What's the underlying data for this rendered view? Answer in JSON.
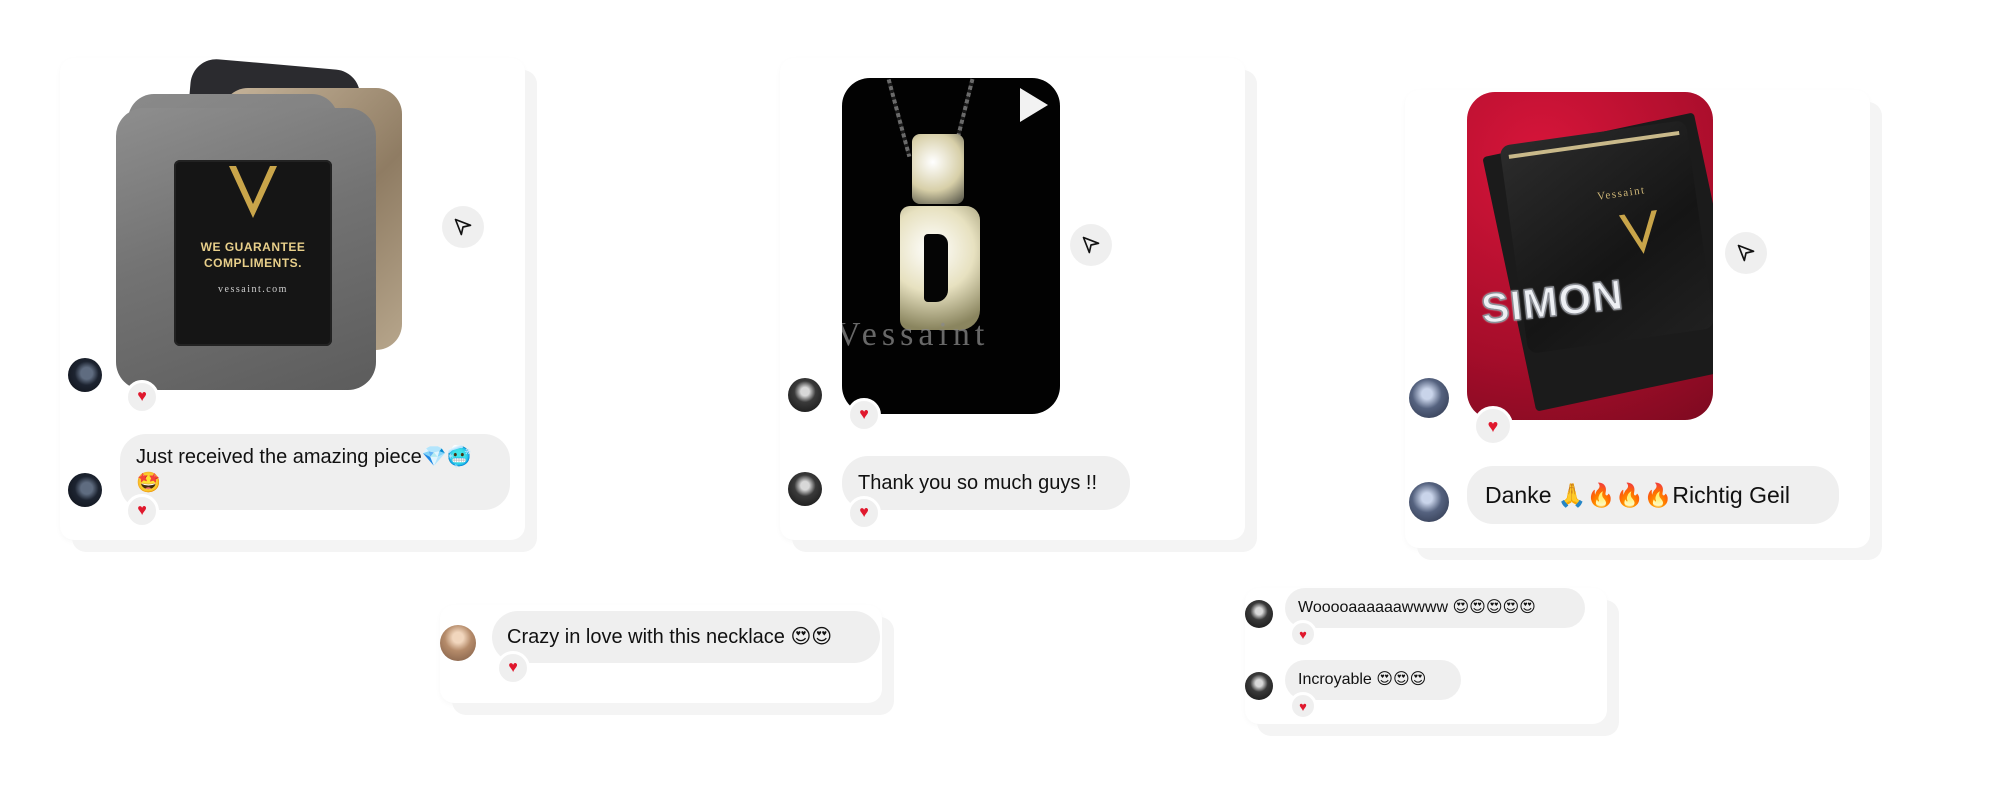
{
  "cards": [
    {
      "photo": {
        "tagline_line1": "WE GUARANTEE",
        "tagline_line2": "COMPLIMENTS.",
        "url": "vessaint.com"
      },
      "message": "Just received the amazing piece💎🥶\n🤩",
      "reaction": "♥"
    },
    {
      "video": {
        "brand_text": "Vessaint"
      },
      "message": "Thank you so much guys !!",
      "reaction": "♥"
    },
    {
      "photo": {
        "bag_brand": "Vessaint",
        "necklace_name": "SIMON"
      },
      "message": "Danke 🙏🔥🔥🔥Richtig Geil",
      "reaction": "♥"
    },
    {
      "message": "Crazy in love with this necklace 😍😍",
      "reaction": "♥"
    },
    {
      "messages": [
        {
          "text": "Wooooaaaaaawwww 😍😍😍😍😍",
          "reaction": "♥"
        },
        {
          "text": "Incroyable 😍😍😍",
          "reaction": "♥"
        }
      ]
    }
  ],
  "icons": {
    "share": "paper-plane-icon",
    "play": "play-icon",
    "reaction": "heart-icon"
  },
  "colors": {
    "bubble": "#efefef",
    "heart": "#e0182d",
    "gold": "#c9a54a"
  }
}
